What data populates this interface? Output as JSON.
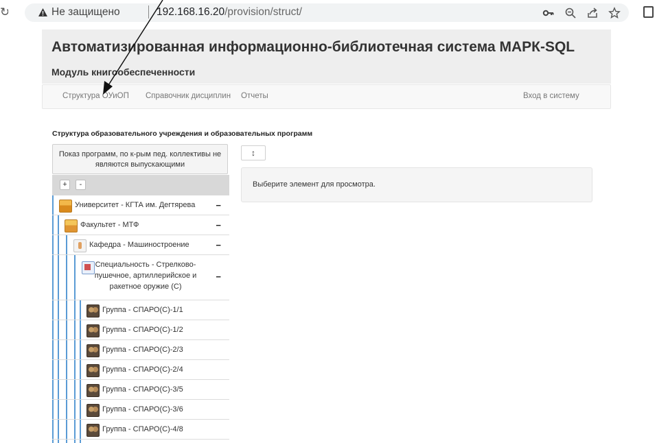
{
  "browser": {
    "security_label": "Не защищено",
    "url_host": "192.168.16.20",
    "url_path": "/provision/struct/"
  },
  "header": {
    "title": "Автоматизированная информационно-библиотечная система МАРК-SQL",
    "subtitle": "Модуль книгообеспеченности"
  },
  "nav": {
    "items": [
      "Структура ОУиОП",
      "Справочник дисциплин",
      "Отчеты"
    ],
    "login": "Вход в систему"
  },
  "section": {
    "title": "Структура образовательного учреждения и образовательных программ"
  },
  "tree": {
    "filter_button": "Показ программ, по к-рым пед. коллективы не являются выпускающими",
    "expand_all": "+",
    "collapse_all": "-",
    "collapse_glyph": "−",
    "nodes": [
      {
        "label": "Университет - КГТА им. Дегтярева",
        "icon": "university-icon"
      },
      {
        "label": "Факультет - МТФ",
        "icon": "faculty-icon"
      },
      {
        "label": "Кафедра - Машиностроение",
        "icon": "department-icon"
      },
      {
        "label": "Специальность - Стрелково-пушечное, артиллерийское и ракетное оружие (С)",
        "icon": "specialty-icon"
      },
      {
        "label": "Группа - СПАРО(С)-1/1",
        "icon": "group-icon"
      },
      {
        "label": "Группа - СПАРО(С)-1/2",
        "icon": "group-icon"
      },
      {
        "label": "Группа - СПАРО(С)-2/3",
        "icon": "group-icon"
      },
      {
        "label": "Группа - СПАРО(С)-2/4",
        "icon": "group-icon"
      },
      {
        "label": "Группа - СПАРО(С)-3/5",
        "icon": "group-icon"
      },
      {
        "label": "Группа - СПАРО(С)-3/6",
        "icon": "group-icon"
      },
      {
        "label": "Группа - СПАРО(С)-4/8",
        "icon": "group-icon"
      }
    ]
  },
  "content": {
    "toggle_glyph": "↕",
    "placeholder": "Выберите элемент для просмотра."
  }
}
